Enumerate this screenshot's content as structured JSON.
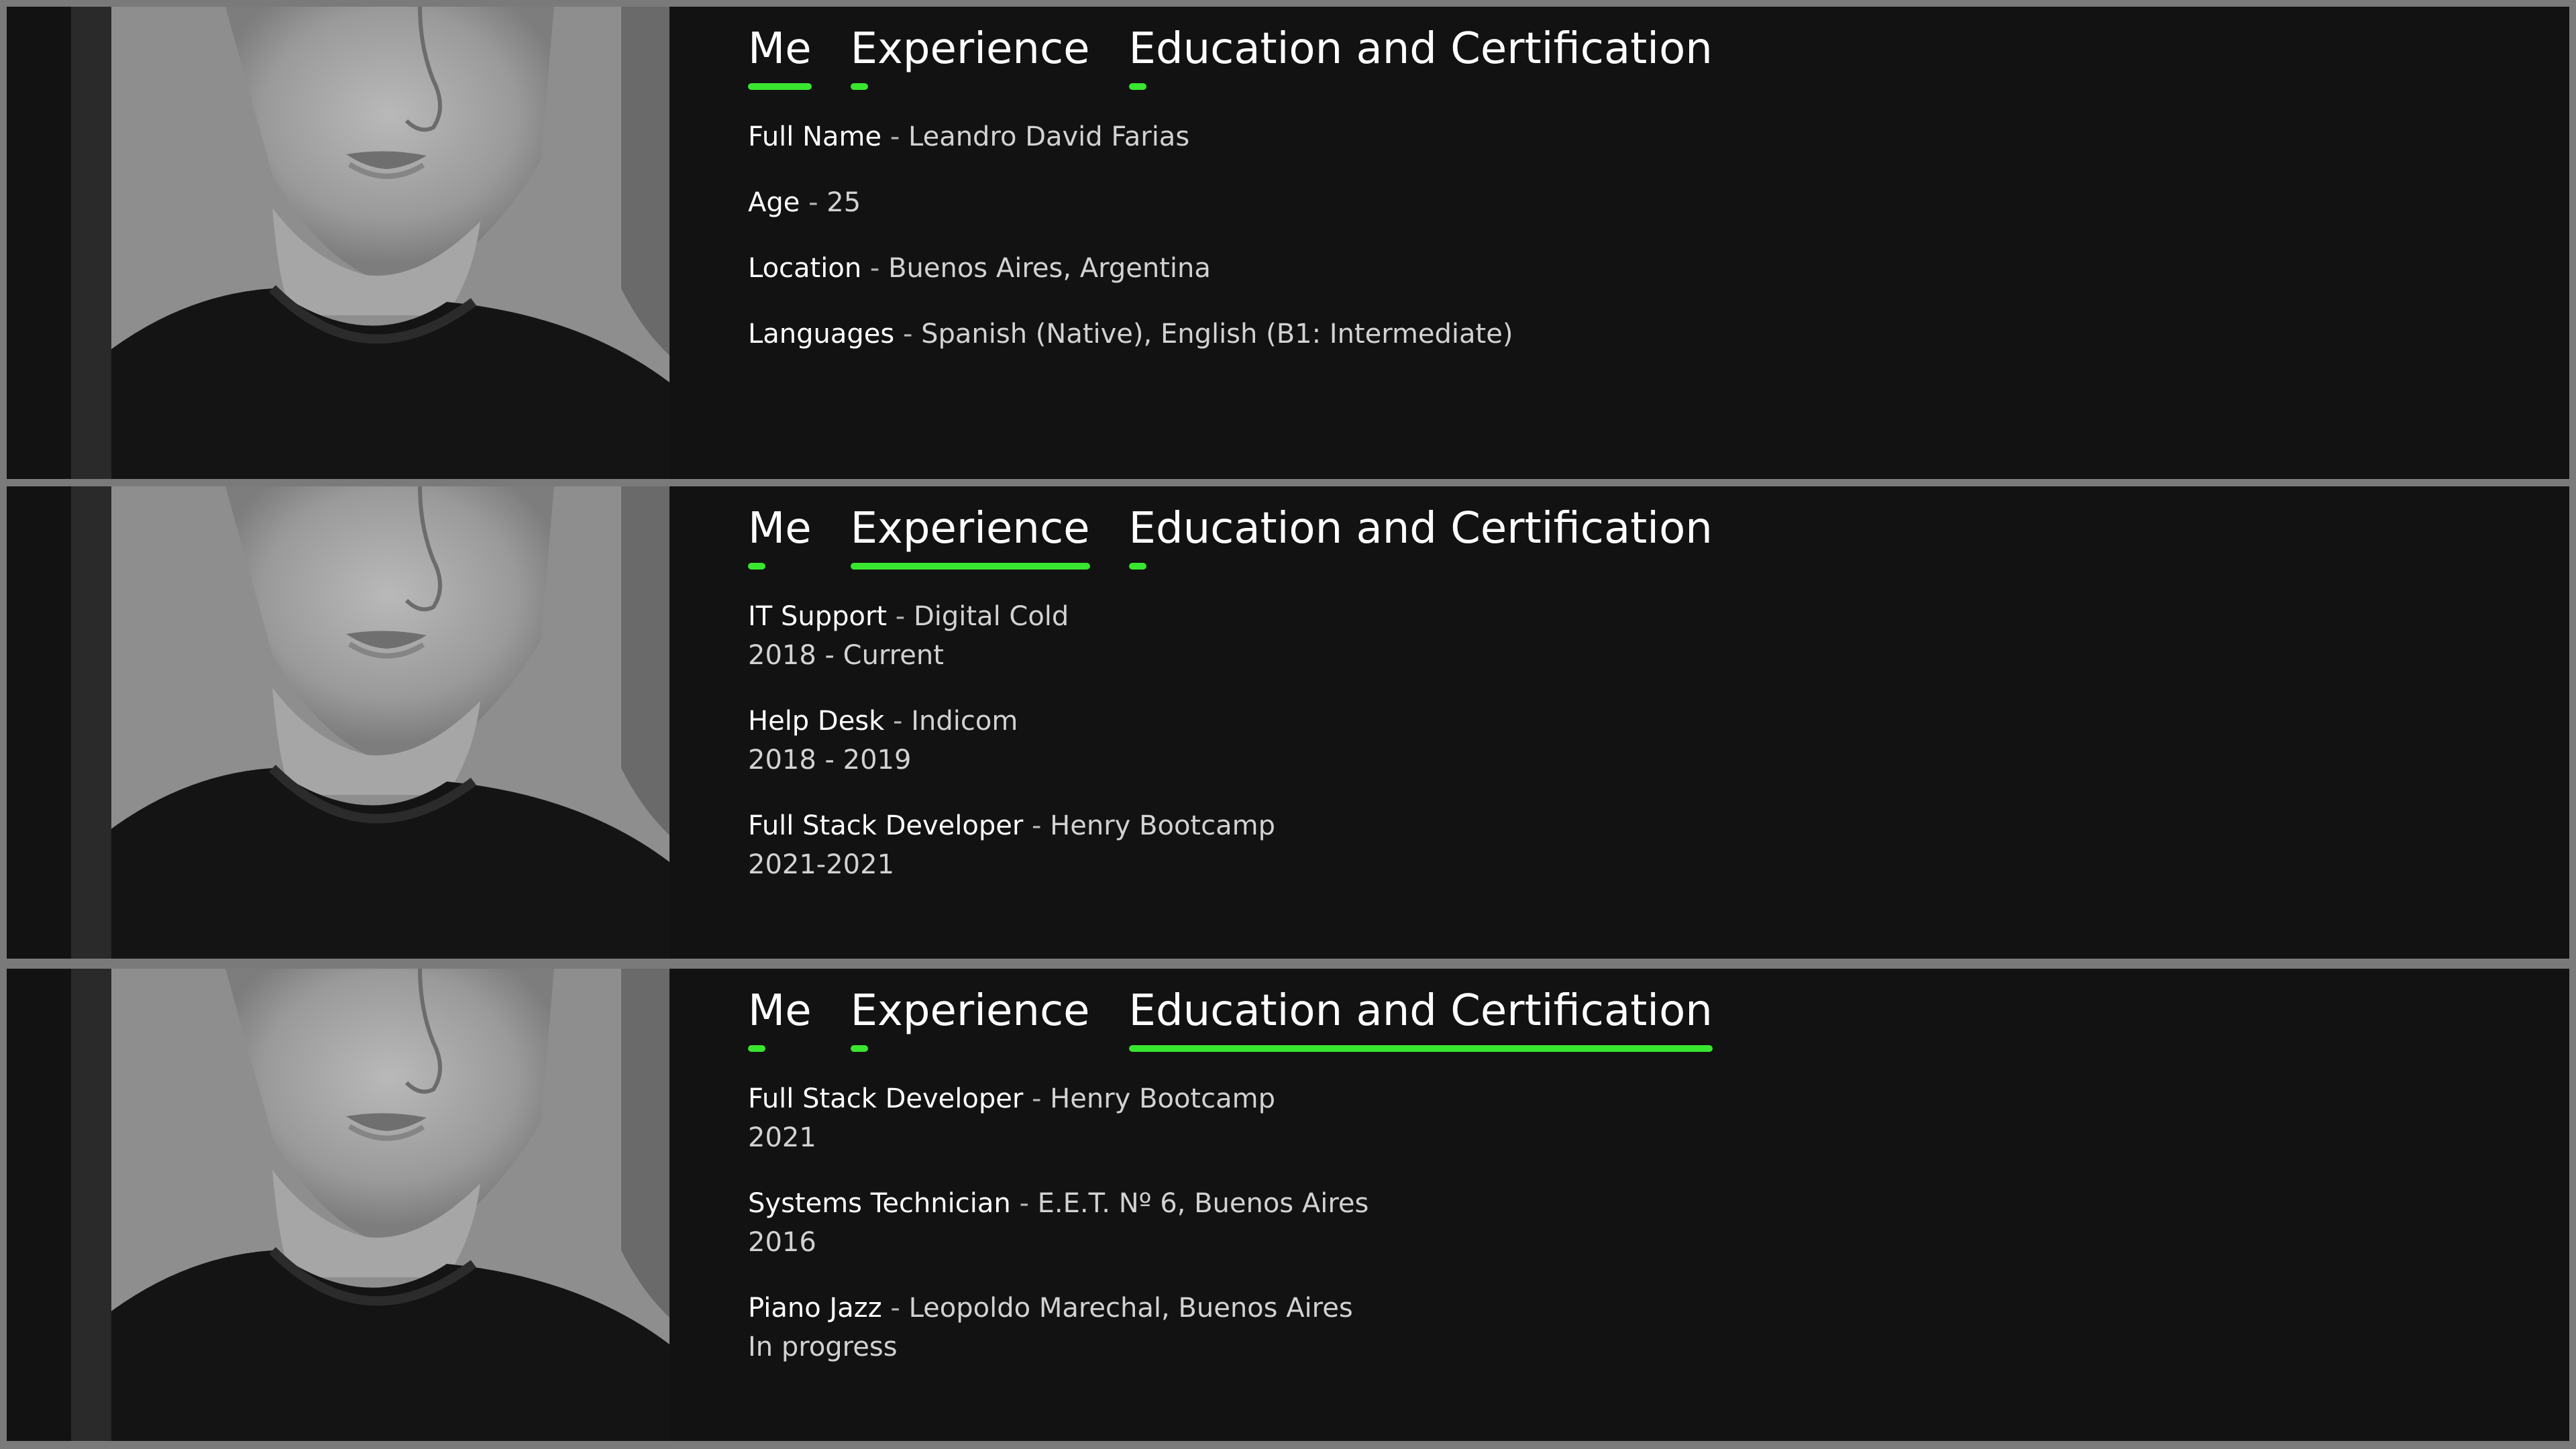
{
  "tabs": [
    "Me",
    "Experience",
    "Education and Certification"
  ],
  "colors": {
    "accent": "#39e62f",
    "panel_background": "#121212",
    "frame": "#7a7a7a",
    "text_primary": "#ffffff",
    "text_secondary": "#d2d2d2"
  },
  "panels": [
    {
      "active_tab": "Me",
      "rows": [
        {
          "key": "Full Name",
          "value": "Leandro David Farias"
        },
        {
          "key": "Age",
          "value": "25"
        },
        {
          "key": "Location",
          "value": "Buenos Aires, Argentina"
        },
        {
          "key": "Languages",
          "value": "Spanish (Native), English (B1: Intermediate)"
        }
      ]
    },
    {
      "active_tab": "Experience",
      "rows": [
        {
          "key": "IT Support",
          "value": "Digital Cold",
          "sub": "2018 - Current"
        },
        {
          "key": "Help Desk",
          "value": "Indicom",
          "sub": "2018 - 2019"
        },
        {
          "key": "Full Stack Developer",
          "value": "Henry Bootcamp",
          "sub": "2021-2021"
        }
      ]
    },
    {
      "active_tab": "Education and Certification",
      "rows": [
        {
          "key": "Full Stack Developer",
          "value": "Henry Bootcamp",
          "sub": "2021"
        },
        {
          "key": "Systems Technician",
          "value": "E.E.T. Nº 6, Buenos Aires",
          "sub": "2016"
        },
        {
          "key": "Piano Jazz",
          "value": "Leopoldo Marechal, Buenos Aires",
          "sub": "In progress"
        }
      ]
    }
  ]
}
